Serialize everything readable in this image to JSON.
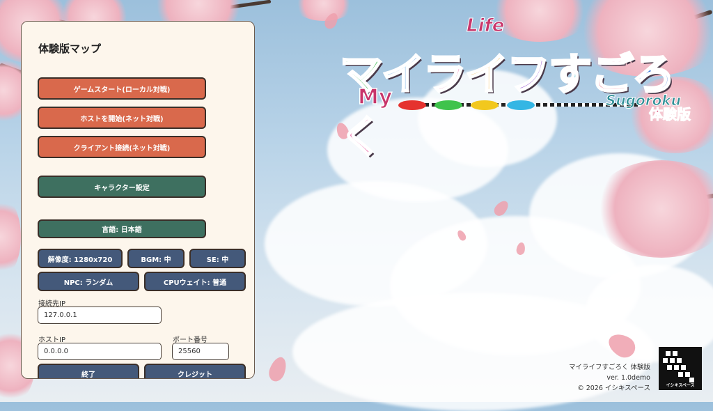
{
  "panel": {
    "title": "体験版マップ",
    "buttons": {
      "game_start": "ゲームスタート(ローカル対戦)",
      "host_start": "ホストを開始(ネット対戦)",
      "client_connect": "クライアント接続(ネット対戦)",
      "character_settings": "キャラクター設定",
      "language": "言語: 日本語",
      "resolution": "解像度: 1280x720",
      "bgm": "BGM: 中",
      "se": "SE: 中",
      "npc": "NPC: ランダム",
      "cpu_wait": "CPUウェイト: 普通",
      "quit": "終了",
      "credits": "クレジット"
    },
    "fields": {
      "connect_ip_label": "接続先IP",
      "connect_ip_value": "127.0.0.1",
      "host_ip_label": "ホストIP",
      "host_ip_value": "0.0.0.0",
      "port_label": "ポート番号",
      "port_value": "25560"
    }
  },
  "logo": {
    "life": "Life",
    "main_chars": [
      "マ",
      "イ",
      "ラ",
      "イ",
      "フ",
      "す",
      "ご",
      "ろ",
      "く"
    ],
    "my": "My",
    "sugoroku": "Sugoroku",
    "demo": "体験版"
  },
  "footer": {
    "game_title": "マイライフすごろく 体験版",
    "version": "ver. 1.0demo",
    "copyright": "© 2026 イシキスペース",
    "brand_logo_text": "イシキスペース"
  },
  "colors": {
    "button_orange": "#d9694c",
    "button_green": "#3e7060",
    "button_navy": "#44597a",
    "panel_bg": "#fdf6ec"
  }
}
